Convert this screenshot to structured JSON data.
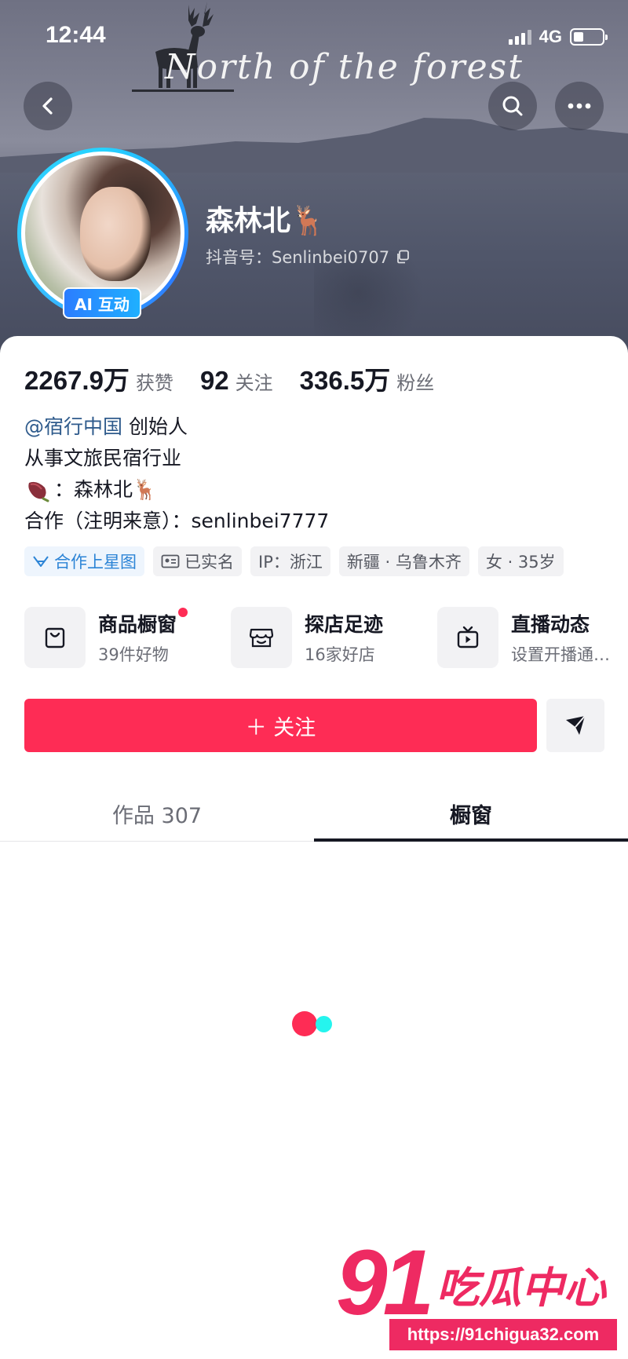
{
  "status_bar": {
    "time": "12:44",
    "network": "4G",
    "battery_level": 0.35
  },
  "cover": {
    "title": "North of the forest"
  },
  "profile": {
    "nickname": "森林北🦌",
    "douyin_id": "抖音号：Senlinbei0707",
    "ai_badge": "AI 互动"
  },
  "stats": [
    {
      "value": "2267.9万",
      "label": "获赞"
    },
    {
      "value": "92",
      "label": "关注"
    },
    {
      "value": "336.5万",
      "label": "粉丝"
    }
  ],
  "bio": {
    "mention": "@宿行中国",
    "role": "创始人",
    "line2": "从事文旅民宿行业",
    "line3_text": "：森林北🦌",
    "line4": "合作（注明来意）：senlinbei7777"
  },
  "tags": [
    "合作上星图",
    "已实名",
    "IP：浙江",
    "新疆 · 乌鲁木齐",
    "女 · 35岁"
  ],
  "features": [
    {
      "title": "商品橱窗",
      "subtitle": "39件好物",
      "icon": "shopping-bag-icon"
    },
    {
      "title": "探店足迹",
      "subtitle": "16家好店",
      "icon": "store-icon"
    },
    {
      "title": "直播动态",
      "subtitle": "设置开播通…",
      "icon": "tv-icon"
    }
  ],
  "actions": {
    "follow_label": "＋ 关注"
  },
  "tabs": {
    "works": "作品 307",
    "showcase": "橱窗"
  },
  "watermark": {
    "number": "91",
    "name": "吃瓜中心",
    "url": "https://91chigua32.com"
  },
  "colors": {
    "accent": "#fe2c55",
    "link": "#2f5b8c",
    "star_tag": "#2c84d6"
  }
}
